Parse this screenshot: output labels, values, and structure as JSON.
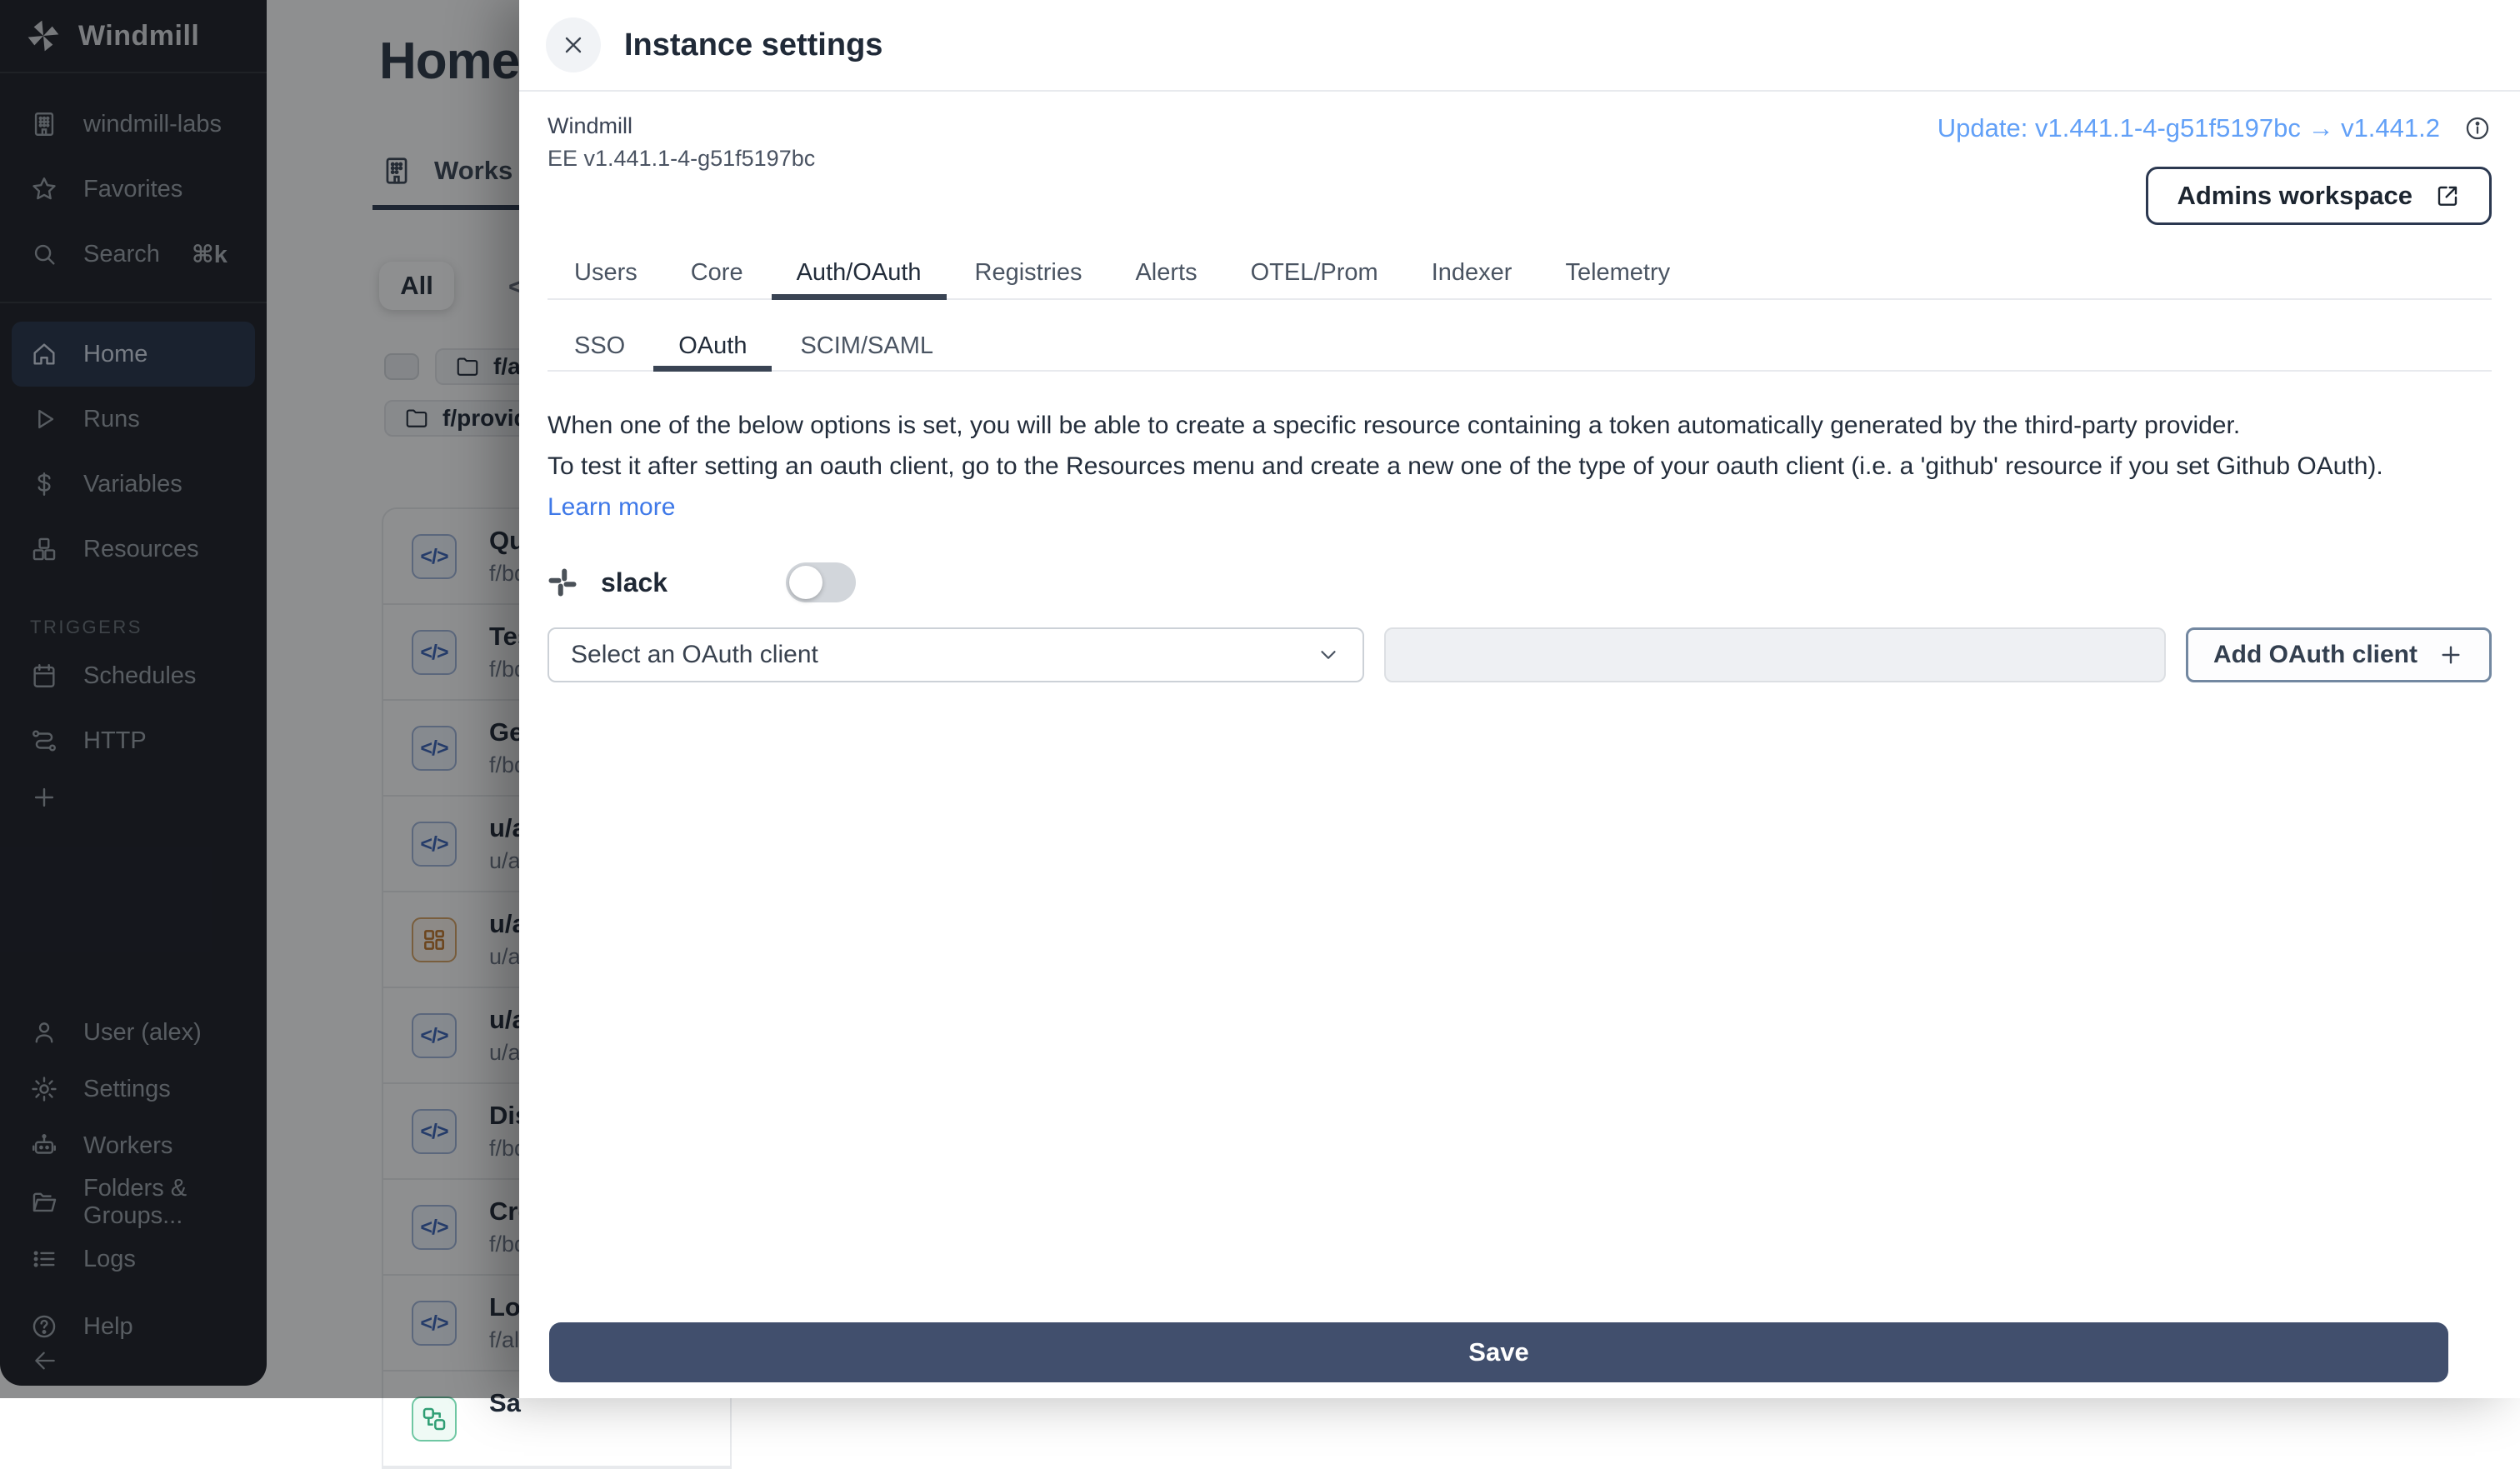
{
  "colors": {
    "sidebar_bg": "#1b1e25",
    "active_item_bg": "#243249",
    "accent_blue": "#3f79e8",
    "update_link_blue": "#62a0f7",
    "save_button_bg": "#414f6d",
    "tab_underline": "#3a4454",
    "code_icon_blue": "#3a63b8",
    "app_icon_orange": "#bf7326",
    "flow_icon_green": "#2f9e74"
  },
  "sidebar": {
    "brand": "Windmill",
    "items_top": [
      {
        "label": "windmill-labs",
        "icon": "building-icon"
      },
      {
        "label": "Favorites",
        "icon": "star-icon"
      },
      {
        "label": "Search",
        "icon": "search-icon",
        "shortcut": "⌘k"
      }
    ],
    "items_main": [
      {
        "label": "Home",
        "icon": "home-icon",
        "active": true
      },
      {
        "label": "Runs",
        "icon": "play-icon"
      },
      {
        "label": "Variables",
        "icon": "dollar-icon"
      },
      {
        "label": "Resources",
        "icon": "cubes-icon"
      }
    ],
    "triggers_label": "TRIGGERS",
    "items_triggers": [
      {
        "label": "Schedules",
        "icon": "calendar-icon"
      },
      {
        "label": "HTTP",
        "icon": "route-icon"
      }
    ],
    "items_bottom": [
      {
        "label": "User (alex)",
        "icon": "user-icon"
      },
      {
        "label": "Settings",
        "icon": "gear-icon"
      },
      {
        "label": "Workers",
        "icon": "robot-icon"
      },
      {
        "label": "Folders & Groups...",
        "icon": "folder-open-icon"
      },
      {
        "label": "Logs",
        "icon": "logs-icon"
      }
    ],
    "help_label": "Help"
  },
  "page": {
    "title": "Home",
    "workspace_tab": "Works",
    "filter_all": "All",
    "filter_code_glyph": "</>",
    "folder_chips": [
      "f/all",
      "f/provide"
    ],
    "rows": [
      {
        "title": "Qu",
        "path": "f/bd",
        "icon": "code-icon",
        "glyph": "</>"
      },
      {
        "title": "Tes",
        "path": "f/bd",
        "icon": "code-icon",
        "glyph": "</>"
      },
      {
        "title": "Ge",
        "path": "f/bd",
        "icon": "code-icon",
        "glyph": "</>"
      },
      {
        "title": "u/a",
        "path": "u/ale",
        "icon": "code-icon",
        "glyph": "</>"
      },
      {
        "title": "u/a",
        "path": "u/ale",
        "icon": "app-grid-icon",
        "glyph": ""
      },
      {
        "title": "u/a",
        "path": "u/ale",
        "icon": "code-icon",
        "glyph": "</>"
      },
      {
        "title": "Dis",
        "path": "f/bd",
        "icon": "code-icon",
        "glyph": "</>"
      },
      {
        "title": "Cre",
        "path": "f/bd",
        "icon": "code-icon",
        "glyph": "</>"
      },
      {
        "title": "Loa",
        "path": "f/all/",
        "icon": "code-icon",
        "glyph": "</>"
      },
      {
        "title": "Sa",
        "path": "",
        "icon": "flow-icon",
        "glyph": ""
      }
    ]
  },
  "drawer": {
    "title": "Instance settings",
    "app_name": "Windmill",
    "version": "EE v1.441.1-4-g51f5197bc",
    "update_link": "Update: v1.441.1-4-g51f5197bc → v1.441.2",
    "admins_workspace_label": "Admins workspace",
    "tabs": [
      {
        "label": "Users"
      },
      {
        "label": "Core"
      },
      {
        "label": "Auth/OAuth",
        "active": true
      },
      {
        "label": "Registries"
      },
      {
        "label": "Alerts"
      },
      {
        "label": "OTEL/Prom"
      },
      {
        "label": "Indexer"
      },
      {
        "label": "Telemetry"
      }
    ],
    "subtabs": [
      {
        "label": "SSO"
      },
      {
        "label": "OAuth",
        "active": true
      },
      {
        "label": "SCIM/SAML"
      }
    ],
    "description_line1": "When one of the below options is set, you will be able to create a specific resource containing a token automatically generated by the third-party provider.",
    "description_line2": "To test it after setting an oauth client, go to the Resources menu and create a new one of the type of your oauth client (i.e. a 'github' resource if you set Github OAuth).",
    "learn_more": "Learn more",
    "provider": {
      "name": "slack",
      "enabled": false
    },
    "select_placeholder": "Select an OAuth client",
    "client_secret_value": "",
    "add_client_label": "Add OAuth client",
    "save_label": "Save"
  }
}
